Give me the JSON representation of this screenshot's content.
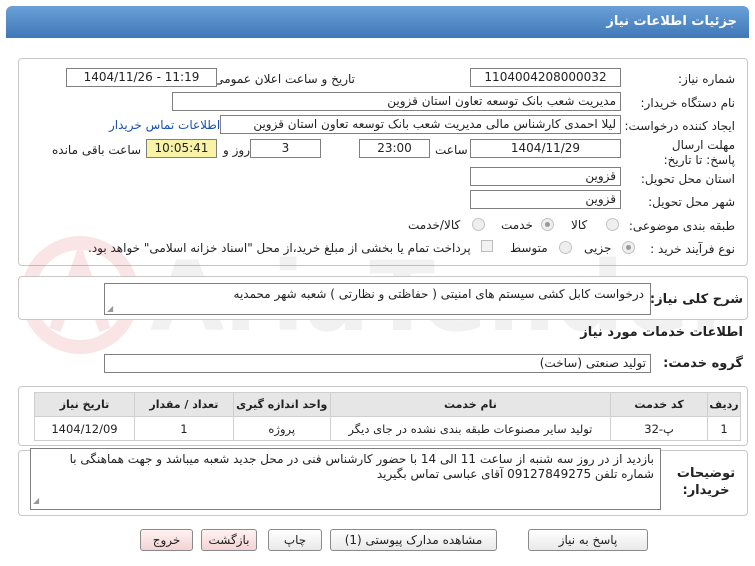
{
  "header": {
    "title": "جزئیات اطلاعات نیاز"
  },
  "form": {
    "need_number_label": "شماره نیاز:",
    "need_number": "1104004208000032",
    "announce_label": "تاریخ و ساعت اعلان عمومی:",
    "announce_value": "1404/11/26 - 11:19",
    "buyer_org_label": "نام دستگاه خریدار:",
    "buyer_org": "مدیریت شعب بانک توسعه تعاون استان قزوین",
    "creator_label": "ایجاد کننده درخواست:",
    "creator": "لیلا احمدی کارشناس مالی مدیریت شعب بانک توسعه تعاون استان قزوین",
    "contact_link": "اطلاعات تماس خریدار",
    "deadline_label": "مهلت ارسال پاسخ: تا تاریخ:",
    "deadline_date": "1404/11/29",
    "time_label": "ساعت",
    "deadline_time": "23:00",
    "days_value": "3",
    "days_label": "روز و",
    "remaining_time": "10:05:41",
    "remaining_label": "ساعت باقی مانده",
    "province_label": "استان محل تحویل:",
    "province": "قزوین",
    "city_label": "شهر محل تحویل:",
    "city": "قزوین",
    "category_label": "طبقه بندی موضوعی:",
    "category_options": [
      "کالا",
      "خدمت",
      "کالا/خدمت"
    ],
    "process_label": "نوع فرآیند خرید :",
    "process_options": [
      "جزیی",
      "متوسط"
    ],
    "payment_note": "پرداخت تمام یا بخشی از مبلغ خرید،از محل \"اسناد خزانه اسلامی\" خواهد بود."
  },
  "summary": {
    "label": "شرح کلی نیاز:",
    "text": "درخواست کابل کشی سیستم های امنیتی ( حفاظتی و نظارتی ) شعبه شهر محمدیه"
  },
  "services": {
    "section_title": "اطلاعات خدمات مورد نیاز",
    "group_label": "گروه خدمت:",
    "group_value": "تولید صنعتی (ساخت)",
    "columns": [
      "ردیف",
      "کد خدمت",
      "نام خدمت",
      "واحد اندازه گیری",
      "تعداد / مقدار",
      "تاریخ نیاز"
    ],
    "rows": [
      [
        "1",
        "پ-32",
        "تولید سایر مصنوعات طبقه بندی نشده در جای دیگر",
        "پروژه",
        "1",
        "1404/12/09"
      ]
    ]
  },
  "buyer_notes": {
    "label": "توضیحات خریدار:",
    "text": "بازدید از در روز سه شنبه از ساعت 11 الی 14 با حضور کارشناس فنی در محل جدید شعبه میباشد و جهت هماهنگی با شماره تلفن 09127849275 آقای عباسی تماس بگیرید"
  },
  "buttons": {
    "reply": "پاسخ به نیاز",
    "attachments": "مشاهده مدارک پیوستی (1)",
    "print": "چاپ",
    "back": "بازگشت",
    "exit": "خروج"
  },
  "watermark": {
    "text": "AriaTender.net"
  },
  "colors": {
    "header": "#4a84c4",
    "link": "#1a4fb0",
    "remaining_bg": "#f9f3a8"
  }
}
